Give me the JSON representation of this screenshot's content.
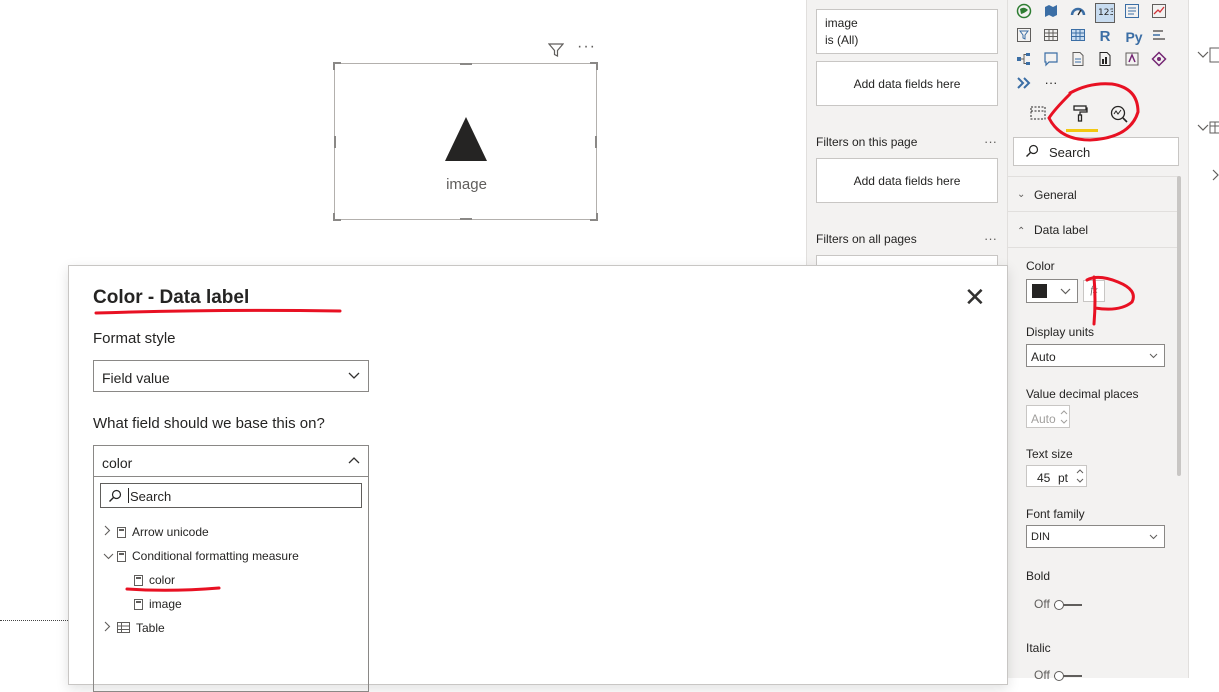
{
  "canvas": {
    "visual": {
      "label": "image"
    }
  },
  "filters": {
    "card_filter": {
      "name": "image",
      "state": "is (All)"
    },
    "visual_add_label": "Add data fields here",
    "page_section": "Filters on this page",
    "page_add_label": "Add data fields here",
    "all_section": "Filters on all pages",
    "dots": "···"
  },
  "viz": {
    "more": "···",
    "r_label": "R",
    "py_label": "Py",
    "search_placeholder": "Search",
    "general_label": "General",
    "data_label_section": "Data label",
    "color_label": "Color",
    "color_swatch": "#252423",
    "fx_label": "fx",
    "display_units_label": "Display units",
    "display_units_value": "Auto",
    "decimal_label": "Value decimal places",
    "decimal_value": "Auto",
    "text_size_label": "Text size",
    "text_size_value": "45",
    "text_size_unit": "pt",
    "font_family_label": "Font family",
    "font_family_value": "DIN",
    "bold_label": "Bold",
    "bold_value": "Off",
    "italic_label": "Italic",
    "italic_value": "Off",
    "accent_color": "#f2c811"
  },
  "dialog": {
    "title": "Color - Data label",
    "format_style_label": "Format style",
    "format_style_value": "Field value",
    "field_question": "What field should we base this on?",
    "field_value": "color",
    "search_placeholder": "Search",
    "tree": [
      {
        "label": "Arrow unicode"
      },
      {
        "label": "Conditional formatting measure"
      },
      {
        "label": "color"
      },
      {
        "label": "image"
      },
      {
        "label": "Table"
      }
    ]
  },
  "annotation_color": "#e81123"
}
